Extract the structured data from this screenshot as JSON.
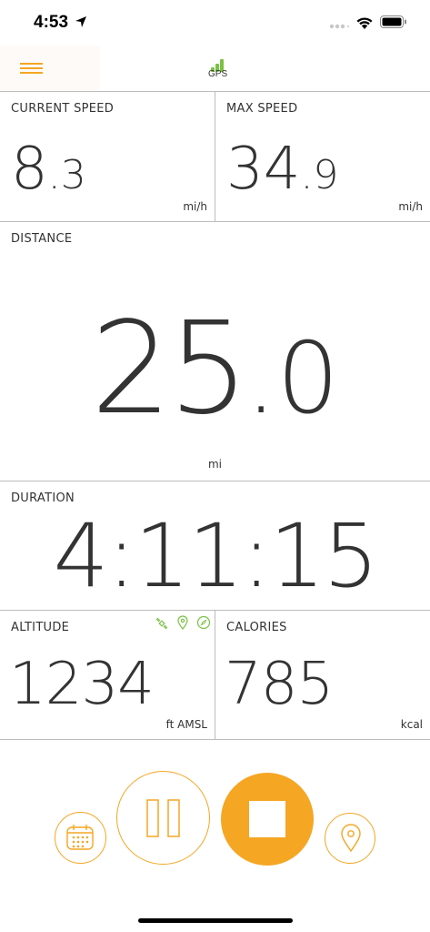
{
  "status": {
    "time": "4:53"
  },
  "nav": {
    "gps_label": "GPS"
  },
  "current_speed": {
    "label": "CURRENT SPEED",
    "int": "8",
    "dec": ".3",
    "unit": "mi/h"
  },
  "max_speed": {
    "label": "MAX SPEED",
    "int": "34",
    "dec": ".9",
    "unit": "mi/h"
  },
  "distance": {
    "label": "DISTANCE",
    "int": "25",
    "dec": ".0",
    "unit": "mi"
  },
  "duration": {
    "label": "DURATION",
    "value": "4:11:15"
  },
  "altitude": {
    "label": "ALTITUDE",
    "value": "1234",
    "unit": "ft AMSL"
  },
  "calories": {
    "label": "CALORIES",
    "value": "785",
    "unit": "kcal"
  },
  "colors": {
    "accent": "#f5a623",
    "green": "#7ac143",
    "text": "#333333",
    "divider": "#bdbdbd"
  },
  "icons": [
    "location-arrow-icon",
    "signal-icon",
    "wifi-icon",
    "battery-icon",
    "menu-icon",
    "gps-signal-icon",
    "satellite-icon",
    "map-pin-icon",
    "compass-icon",
    "calendar-icon",
    "pause-icon",
    "stop-icon",
    "location-pin-icon"
  ]
}
